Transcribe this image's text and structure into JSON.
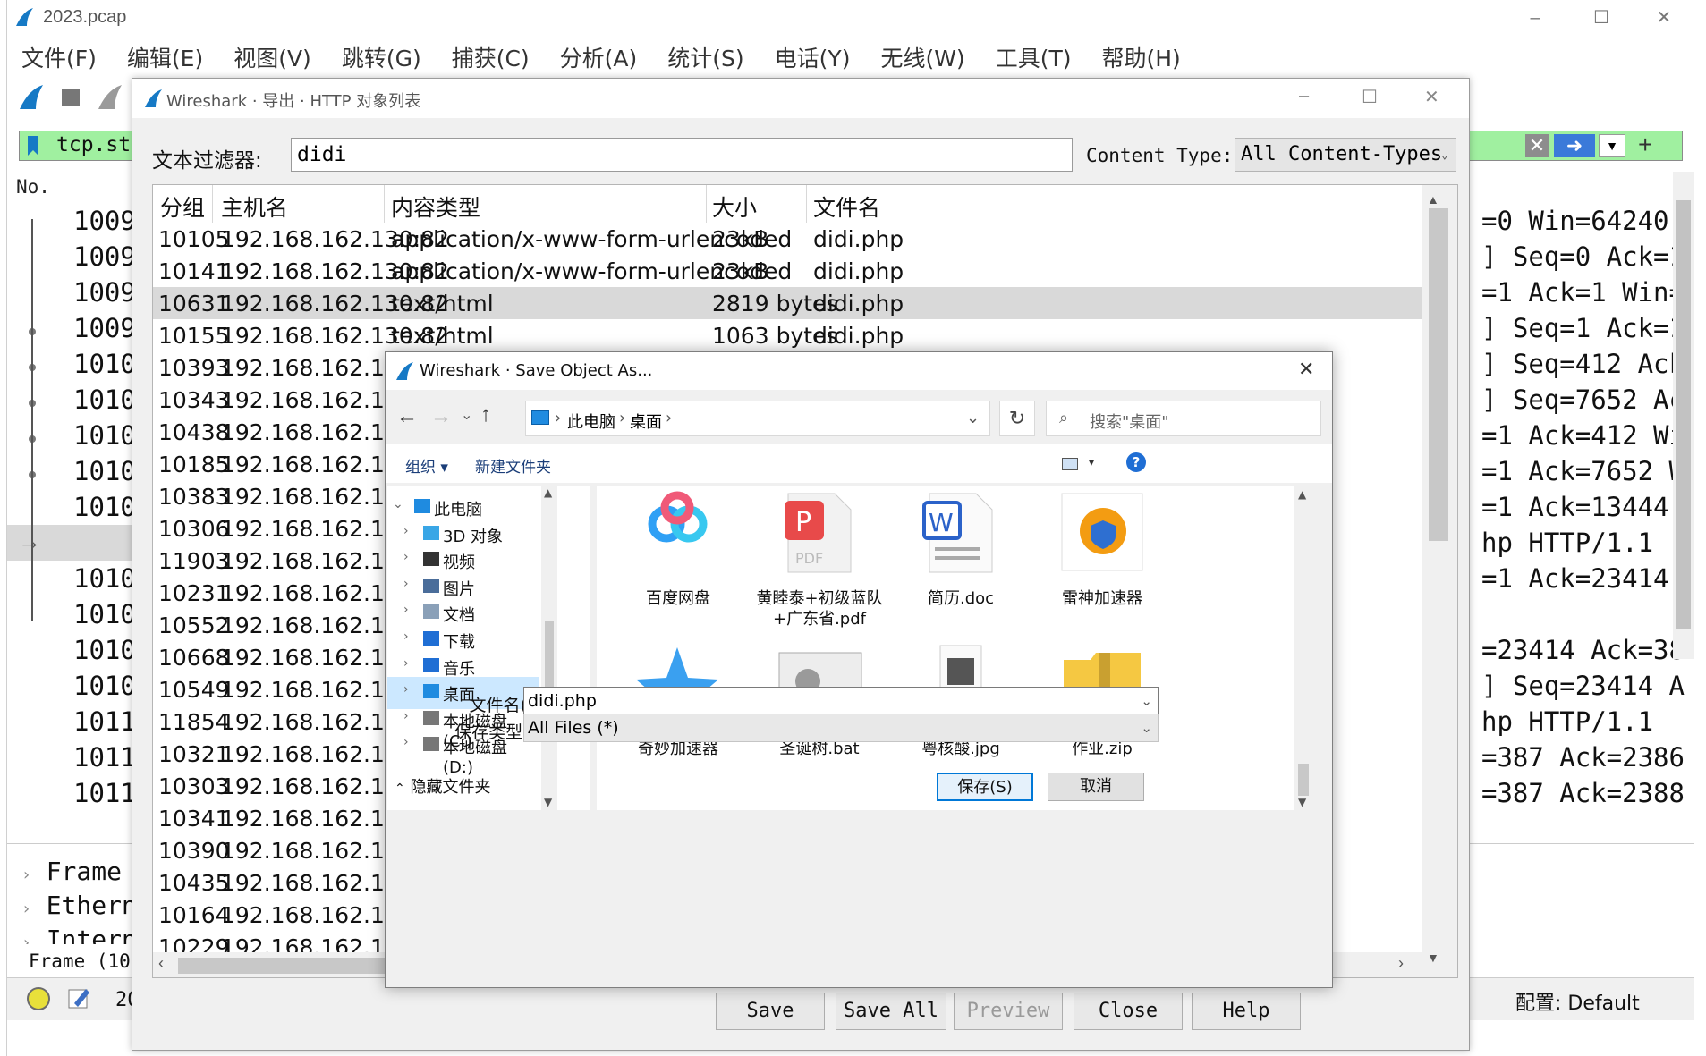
{
  "main": {
    "title": "2023.pcap",
    "menu": [
      "文件(F)",
      "编辑(E)",
      "视图(V)",
      "跳转(G)",
      "捕获(C)",
      "分析(A)",
      "统计(S)",
      "电话(Y)",
      "无线(W)",
      "工具(T)",
      "帮助(H)"
    ],
    "filter_text": "tcp.stre",
    "col_no": "No.",
    "packet_numbers": [
      "10096",
      "10097",
      "10098",
      "10099",
      "10100",
      "10101",
      "10102",
      "10103",
      "10104",
      "10105",
      "10106",
      "10107",
      "10108",
      "10109",
      "10110",
      "10111",
      "10112"
    ],
    "right_texts": [
      "=0 Win=64240",
      "] Seq=0 Ack=1",
      "=1 Ack=1 Win=",
      "] Seq=1 Ack=1",
      "] Seq=412 Ack",
      "] Seq=7652 Ac",
      "=1 Ack=412 Wi",
      "=1 Ack=7652 W",
      "=1 Ack=13444 ",
      "hp HTTP/1.1",
      "=1 Ack=23414 ",
      "",
      "=23414 Ack=38",
      "] Seq=23414 A",
      "hp HTTP/1.1",
      "=387 Ack=2386",
      "=387 Ack=2388"
    ],
    "details": [
      "Frame",
      "Ethern",
      "Intern"
    ],
    "status_frame": "Frame (100",
    "status_num": "20",
    "profile": "配置: Default"
  },
  "http_dialog": {
    "title": "Wireshark · 导出 · HTTP 对象列表",
    "filter_label": "文本过滤器:",
    "filter_value": "didi",
    "ct_label": "Content Type:",
    "ct_value": "All Content-Types",
    "columns": [
      "分组",
      "主机名",
      "内容类型",
      "大小",
      "文件名"
    ],
    "rows": [
      {
        "packet": "10105",
        "host": "192.168.162.130:82",
        "ctype": "application/x-www-form-urlencoded",
        "size": "23kB",
        "file": "didi.php"
      },
      {
        "packet": "10141",
        "host": "192.168.162.130:82",
        "ctype": "application/x-www-form-urlencoded",
        "size": "23kB",
        "file": "didi.php"
      },
      {
        "packet": "10631",
        "host": "192.168.162.130:82",
        "ctype": "text/html",
        "size": "2819 bytes",
        "file": "didi.php"
      },
      {
        "packet": "10155",
        "host": "192.168.162.130:82",
        "ctype": "text/html",
        "size": "1063 bytes",
        "file": "didi.php"
      },
      {
        "packet": "10393",
        "host": "192.168.162.13"
      },
      {
        "packet": "10343",
        "host": "192.168.162.13"
      },
      {
        "packet": "10438",
        "host": "192.168.162.13"
      },
      {
        "packet": "10185",
        "host": "192.168.162.13"
      },
      {
        "packet": "10383",
        "host": "192.168.162.13"
      },
      {
        "packet": "10306",
        "host": "192.168.162.13"
      },
      {
        "packet": "11903",
        "host": "192.168.162.13"
      },
      {
        "packet": "10231",
        "host": "192.168.162.13"
      },
      {
        "packet": "10552",
        "host": "192.168.162.13"
      },
      {
        "packet": "10668",
        "host": "192.168.162.13"
      },
      {
        "packet": "10549",
        "host": "192.168.162.13"
      },
      {
        "packet": "11854",
        "host": "192.168.162.13"
      },
      {
        "packet": "10321",
        "host": "192.168.162.13"
      },
      {
        "packet": "10303",
        "host": "192.168.162.13"
      },
      {
        "packet": "10341",
        "host": "192.168.162.13"
      },
      {
        "packet": "10390",
        "host": "192.168.162.13"
      },
      {
        "packet": "10435",
        "host": "192.168.162.13"
      },
      {
        "packet": "10164",
        "host": "192.168.162.13"
      },
      {
        "packet": "10229",
        "host": "192.168.162.13"
      }
    ],
    "buttons": {
      "save": "Save",
      "save_all": "Save All",
      "preview": "Preview",
      "close": "Close",
      "help": "Help"
    }
  },
  "save_dialog": {
    "title": "Wireshark · Save Object As...",
    "breadcrumb": [
      "此电脑",
      "桌面"
    ],
    "search_placeholder": "搜索\"桌面\"",
    "organize": "组织",
    "new_folder": "新建文件夹",
    "tree": [
      "此电脑",
      "3D 对象",
      "视频",
      "图片",
      "文档",
      "下载",
      "音乐",
      "桌面",
      "本地磁盘 (C:)",
      "本地磁盘 (D:)"
    ],
    "files": [
      "百度网盘",
      "黄睦泰+初级蓝队+广东省.pdf",
      "简历.doc",
      "雷神加速器",
      "奇妙加速器",
      "圣诞树.bat",
      "粤核酸.jpg",
      "作业.zip"
    ],
    "filename_label": "文件名(N):",
    "filename_value": "didi.php",
    "filetype_label": "保存类型(T):",
    "filetype_value": "All Files (*)",
    "hide_folders": "隐藏文件夹",
    "save": "保存(S)",
    "cancel": "取消"
  },
  "colors": {
    "accent": "#0078d7",
    "filter_green": "#a0f0a0",
    "selection": "#d9d9d9",
    "tree_selection": "#cce8ff"
  }
}
